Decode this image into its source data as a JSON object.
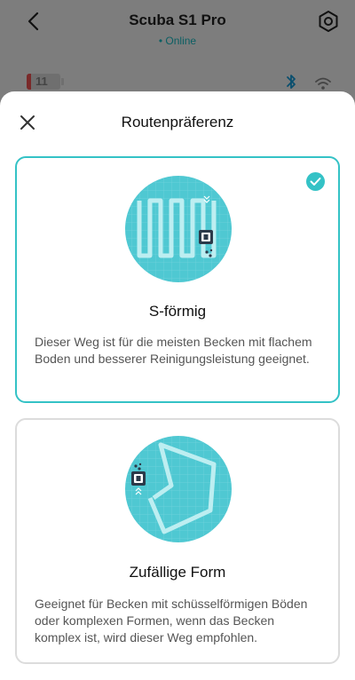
{
  "header": {
    "title": "Scuba S1 Pro",
    "status": "• Online",
    "battery_level": "11"
  },
  "icons": {
    "back": "chevron-left-icon",
    "settings": "hexagon-settings-icon",
    "bluetooth": "bluetooth-icon",
    "wifi": "wifi-icon",
    "close": "close-icon",
    "check": "checkmark-circle-icon"
  },
  "sheet": {
    "title": "Routenpräferenz",
    "options": [
      {
        "title": "S-förmig",
        "description": "Dieser Weg ist für die meisten Becken mit flachem Boden und besserer Reinigungsleistung geeignet.",
        "selected": true
      },
      {
        "title": "Zufällige Form",
        "description": "Geeignet für Becken mit schüsselförmigen Böden oder komplexen Formen, wenn das Becken komplex ist, wird dieser Weg empfohlen.",
        "selected": false
      }
    ]
  },
  "colors": {
    "accent": "#34c2c6",
    "illustration_bg": "#4fc8d2",
    "overlay": "#7d7d7d"
  }
}
